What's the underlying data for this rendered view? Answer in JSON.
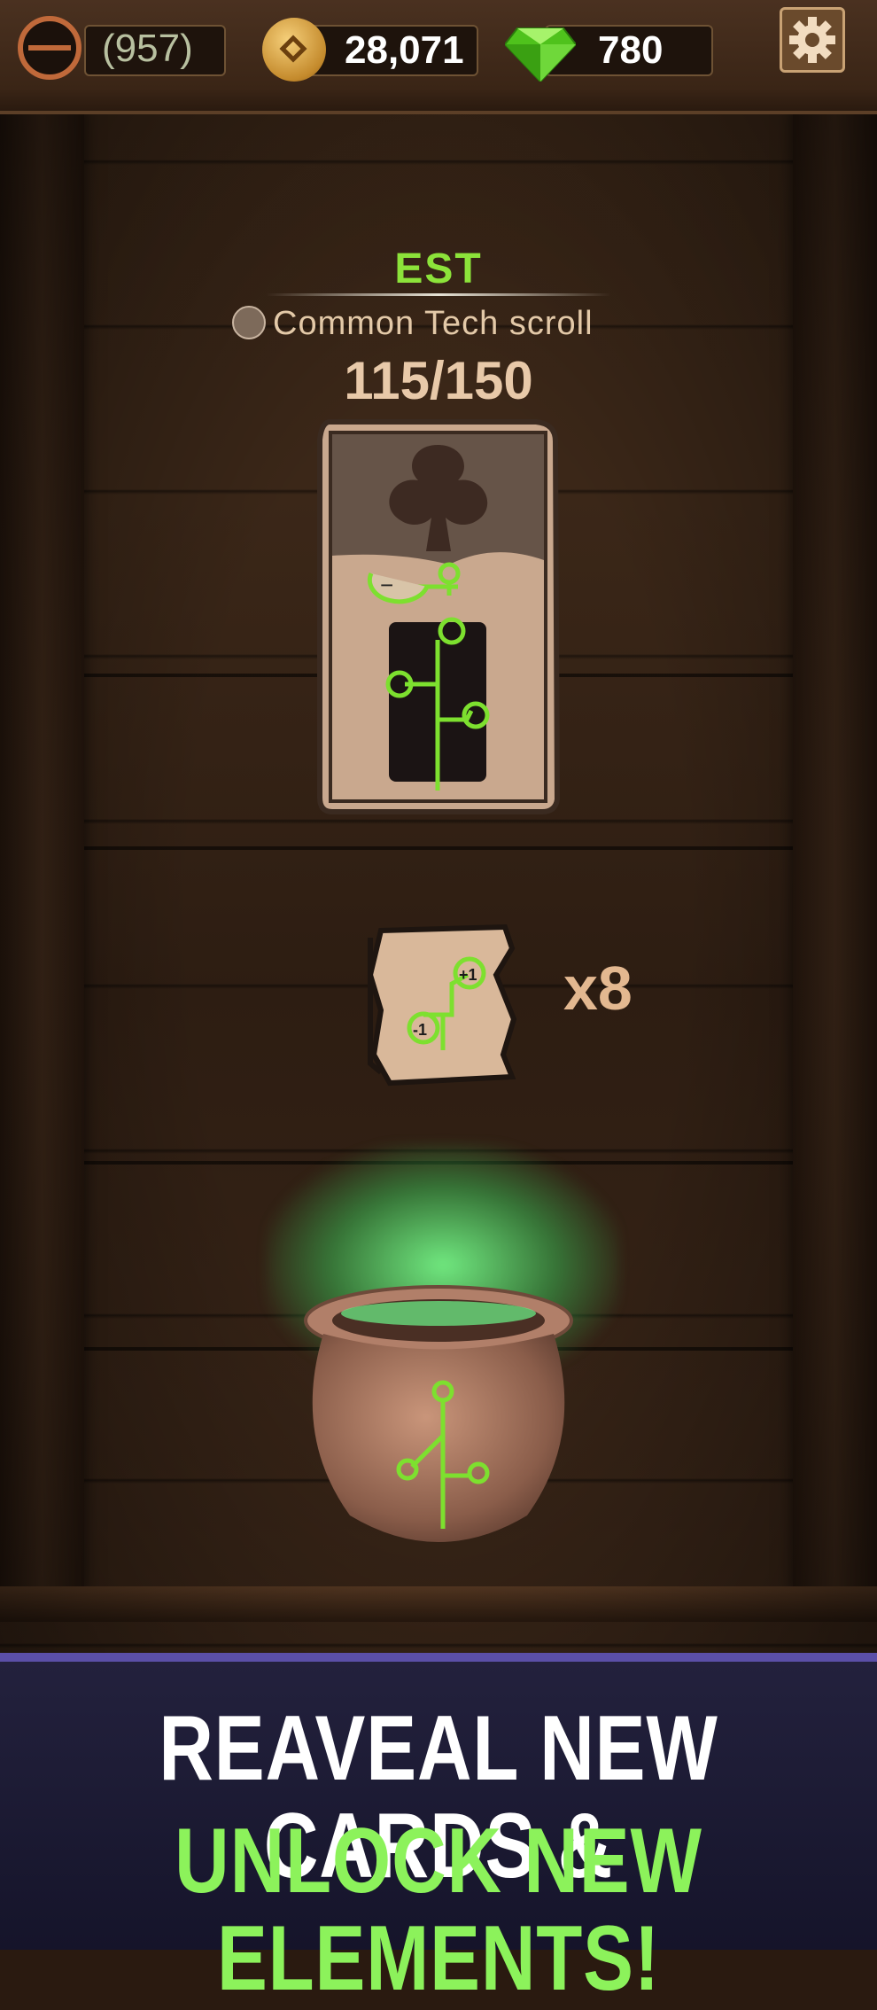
{
  "top_bar": {
    "level_text": "(957)",
    "coins": "28,071",
    "gems": "780"
  },
  "scroll": {
    "tag": "EST",
    "name": "Common  Tech scroll",
    "progress_text": "115/150",
    "progress_value": 0.7667
  },
  "reward": {
    "count": "x8",
    "badge_plus": "+1",
    "badge_minus": "-1"
  },
  "banner": {
    "line1": "REAVEAL NEW CARDS &",
    "line2": "UNLOCK NEW ELEMENTS!"
  },
  "colors": {
    "accent_green": "#8ce33a",
    "banner_bg": "#1b1a33",
    "banner_border": "#5b4fa8"
  },
  "icons": [
    "level-ring-icon",
    "coin-icon",
    "gem-icon",
    "gear-icon",
    "scroll-type-icon",
    "circuit-icon",
    "cauldron-icon"
  ]
}
